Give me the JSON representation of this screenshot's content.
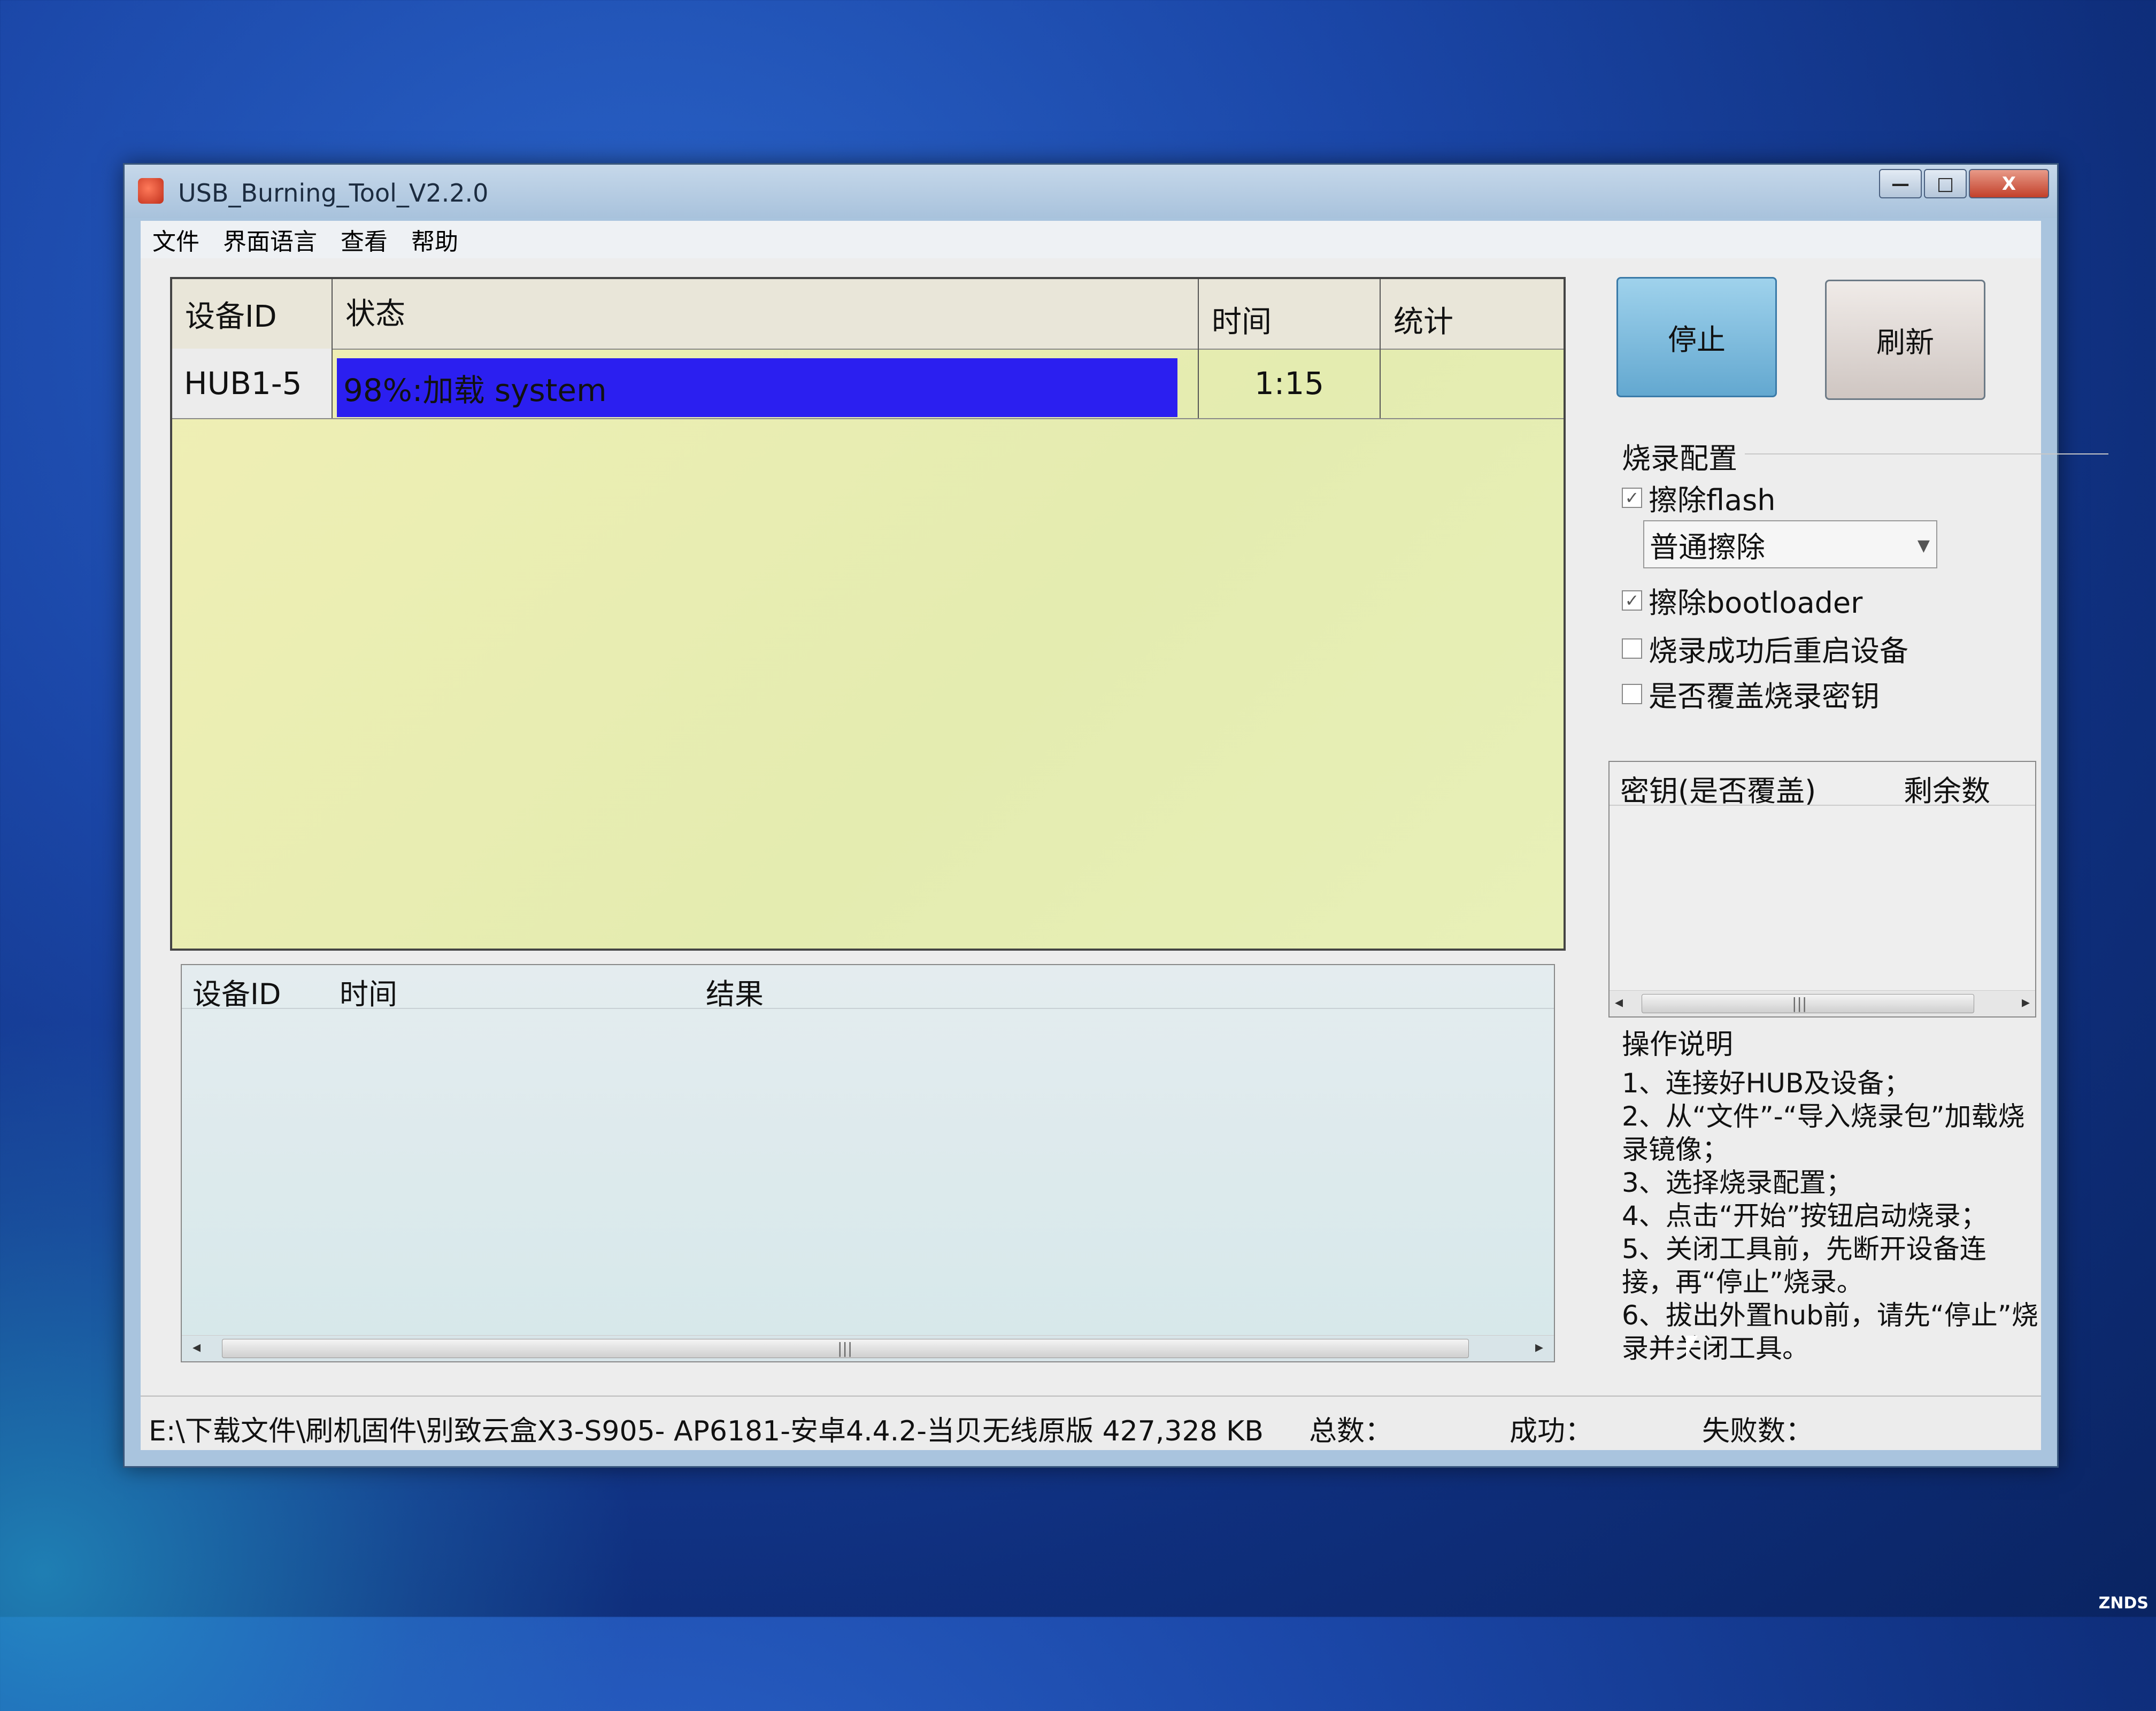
{
  "window": {
    "title": "USB_Burning_Tool_V2.2.0",
    "controls": {
      "minimize": "—",
      "maximize": "□",
      "close": "X"
    }
  },
  "menu": [
    "文件",
    "界面语言",
    "查看",
    "帮助"
  ],
  "device_table": {
    "headers": {
      "device_id": "设备ID",
      "status": "状态",
      "time": "时间",
      "stats": "统计"
    },
    "rows": [
      {
        "device_id": "HUB1-5",
        "status": "98%:加载 system",
        "progress": 0.98,
        "time": "1:15",
        "stats": ""
      }
    ]
  },
  "buttons": {
    "stop": "停止",
    "refresh": "刷新"
  },
  "burn_config": {
    "title": "烧录配置",
    "erase_flash": {
      "label": "擦除flash",
      "checked": true
    },
    "erase_mode": "普通擦除",
    "erase_bootloader": {
      "label": "擦除bootloader",
      "checked": true
    },
    "reboot_after": {
      "label": "烧录成功后重启设备",
      "checked": false
    },
    "overwrite_key": {
      "label": "是否覆盖烧录密钥",
      "checked": false
    }
  },
  "key_table": {
    "headers": {
      "key": "密钥(是否覆盖)",
      "remaining": "剩余数"
    }
  },
  "instructions": {
    "title": "操作说明",
    "lines": [
      "1、连接好HUB及设备；",
      "2、从“文件”-“导入烧录包”加载烧录镜像；",
      "3、选择烧录配置；",
      "4、点击“开始”按钮启动烧录；",
      "5、关闭工具前，先断开设备连接，再“停止”烧录。",
      "6、拔出外置hub前，请先“停止”烧录并关闭工具。"
    ]
  },
  "log_table": {
    "headers": {
      "device_id": "设备ID",
      "time": "时间",
      "result": "结果"
    }
  },
  "statusbar": {
    "file": "E:\\下载文件\\刷机固件\\别致云盒X3-S905- AP6181-安卓4.4.2-当贝无线原版 427,328 KB",
    "total": "总数：",
    "success": "成功：",
    "fail": "失败数："
  },
  "scroll_grip": "|||",
  "desktop_logo": "ZNDS"
}
